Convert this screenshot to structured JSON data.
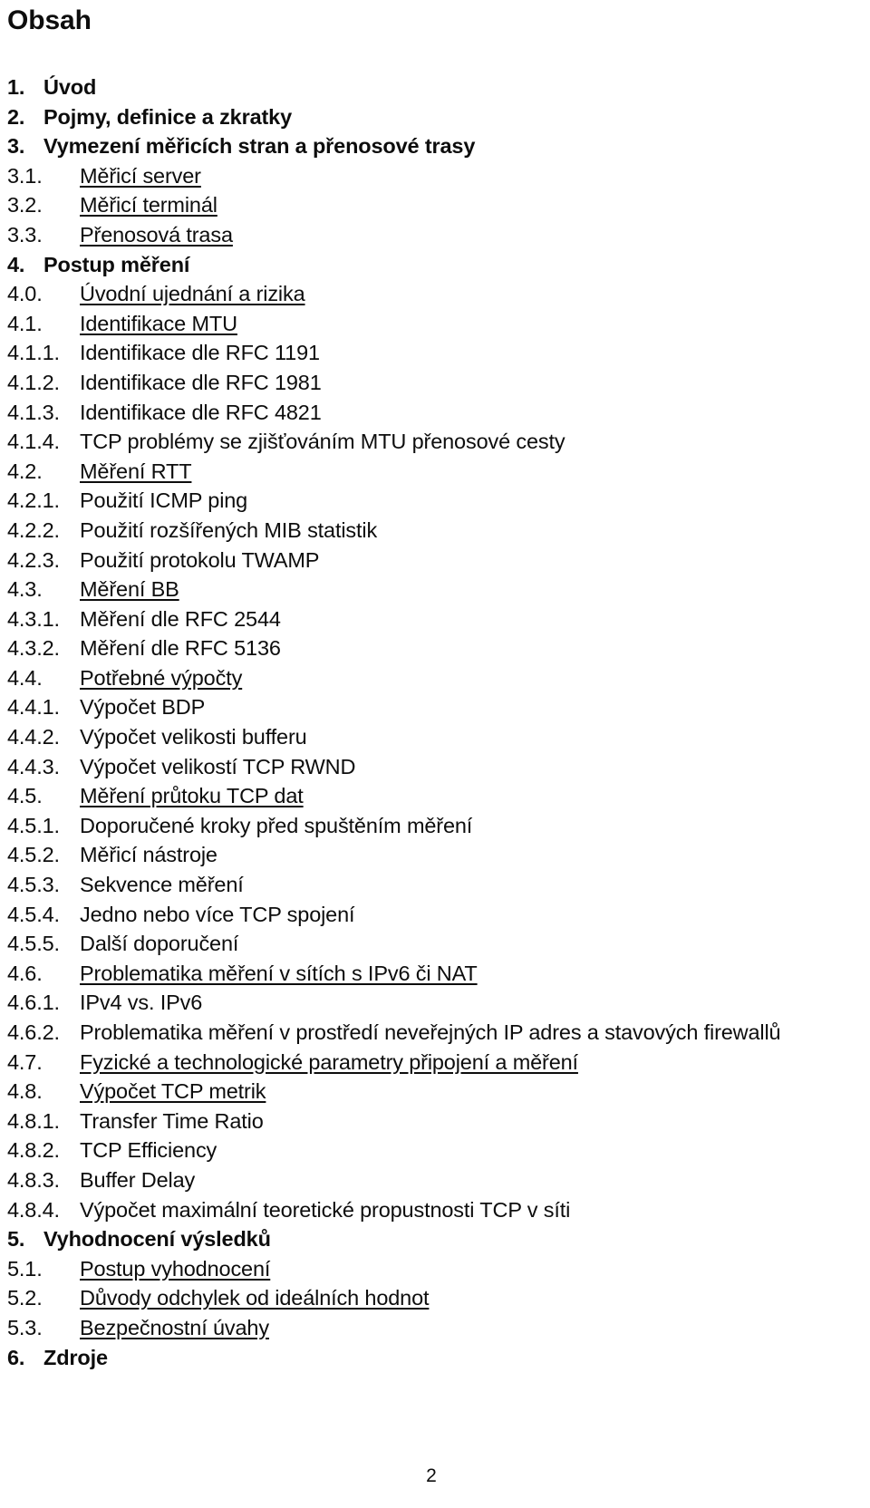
{
  "document": {
    "heading": "Obsah",
    "page_number": "2",
    "text_color": "#0d0d0d",
    "background_color": "#ffffff"
  },
  "toc": {
    "entries": [
      {
        "number": "1.",
        "label": "Úvod",
        "level": 1,
        "underline": false
      },
      {
        "number": "2.",
        "label": "Pojmy, definice a zkratky",
        "level": 1,
        "underline": false
      },
      {
        "number": "3.",
        "label": "Vymezení měřicích stran a přenosové trasy",
        "level": 1,
        "underline": false
      },
      {
        "number": "3.1.",
        "label": "Měřicí server",
        "level": 2,
        "underline": true
      },
      {
        "number": "3.2.",
        "label": "Měřicí terminál",
        "level": 2,
        "underline": true
      },
      {
        "number": "3.3.",
        "label": "Přenosová trasa",
        "level": 2,
        "underline": true
      },
      {
        "number": "4.",
        "label": "Postup měření",
        "level": 1,
        "underline": false
      },
      {
        "number": "4.0.",
        "label": "Úvodní ujednání a rizika",
        "level": 2,
        "underline": true
      },
      {
        "number": "4.1.",
        "label": "Identifikace MTU",
        "level": 2,
        "underline": true
      },
      {
        "number": "4.1.1.",
        "label": "Identifikace dle RFC 1191",
        "level": 3,
        "underline": false
      },
      {
        "number": "4.1.2.",
        "label": "Identifikace dle RFC 1981",
        "level": 3,
        "underline": false
      },
      {
        "number": "4.1.3.",
        "label": "Identifikace dle RFC 4821",
        "level": 3,
        "underline": false
      },
      {
        "number": "4.1.4.",
        "label": "TCP problémy se zjišťováním MTU přenosové cesty",
        "level": 3,
        "underline": false
      },
      {
        "number": "4.2.",
        "label": "Měření RTT",
        "level": 2,
        "underline": true
      },
      {
        "number": "4.2.1.",
        "label": "Použití ICMP ping",
        "level": 3,
        "underline": false
      },
      {
        "number": "4.2.2.",
        "label": "Použití rozšířených MIB statistik",
        "level": 3,
        "underline": false
      },
      {
        "number": "4.2.3.",
        "label": "Použití protokolu TWAMP",
        "level": 3,
        "underline": false
      },
      {
        "number": "4.3.",
        "label": "Měření BB",
        "level": 2,
        "underline": true
      },
      {
        "number": "4.3.1.",
        "label": "Měření dle RFC 2544",
        "level": 3,
        "underline": false
      },
      {
        "number": "4.3.2.",
        "label": "Měření dle RFC 5136",
        "level": 3,
        "underline": false
      },
      {
        "number": "4.4.",
        "label": "Potřebné výpočty",
        "level": 2,
        "underline": true
      },
      {
        "number": "4.4.1.",
        "label": "Výpočet BDP",
        "level": 3,
        "underline": false
      },
      {
        "number": "4.4.2.",
        "label": "Výpočet velikosti bufferu",
        "level": 3,
        "underline": false
      },
      {
        "number": "4.4.3.",
        "label": "Výpočet velikostí TCP RWND",
        "level": 3,
        "underline": false
      },
      {
        "number": "4.5.",
        "label": "Měření průtoku TCP dat",
        "level": 2,
        "underline": true
      },
      {
        "number": "4.5.1.",
        "label": "Doporučené kroky před spuštěním měření",
        "level": 3,
        "underline": false
      },
      {
        "number": "4.5.2.",
        "label": "Měřicí nástroje",
        "level": 3,
        "underline": false
      },
      {
        "number": "4.5.3.",
        "label": "Sekvence měření",
        "level": 3,
        "underline": false
      },
      {
        "number": "4.5.4.",
        "label": "Jedno nebo více TCP spojení",
        "level": 3,
        "underline": false
      },
      {
        "number": "4.5.5.",
        "label": "Další doporučení",
        "level": 3,
        "underline": false
      },
      {
        "number": "4.6.",
        "label": "Problematika měření v sítích s IPv6 či NAT",
        "level": 2,
        "underline": true
      },
      {
        "number": "4.6.1.",
        "label": "IPv4 vs. IPv6",
        "level": 3,
        "underline": false
      },
      {
        "number": "4.6.2.",
        "label": "Problematika měření v prostředí neveřejných IP adres a stavových firewallů",
        "level": 3,
        "underline": false
      },
      {
        "number": "4.7.",
        "label": "Fyzické a technologické parametry připojení a měření",
        "level": 2,
        "underline": true
      },
      {
        "number": "4.8.",
        "label": "Výpočet TCP metrik",
        "level": 2,
        "underline": true
      },
      {
        "number": "4.8.1.",
        "label": "Transfer Time Ratio",
        "level": 3,
        "underline": false
      },
      {
        "number": "4.8.2.",
        "label": "TCP Efficiency",
        "level": 3,
        "underline": false
      },
      {
        "number": "4.8.3.",
        "label": "Buffer Delay",
        "level": 3,
        "underline": false
      },
      {
        "number": "4.8.4.",
        "label": "Výpočet maximální teoretické propustnosti TCP v síti",
        "level": 3,
        "underline": false
      },
      {
        "number": "5.",
        "label": "Vyhodnocení výsledků",
        "level": 1,
        "underline": false
      },
      {
        "number": "5.1.",
        "label": "Postup vyhodnocení",
        "level": 2,
        "underline": true
      },
      {
        "number": "5.2.",
        "label": "Důvody odchylek od ideálních hodnot",
        "level": 2,
        "underline": true
      },
      {
        "number": "5.3.",
        "label": "Bezpečnostní úvahy",
        "level": 2,
        "underline": true
      },
      {
        "number": "6.",
        "label": "Zdroje",
        "level": 1,
        "underline": false
      }
    ]
  }
}
